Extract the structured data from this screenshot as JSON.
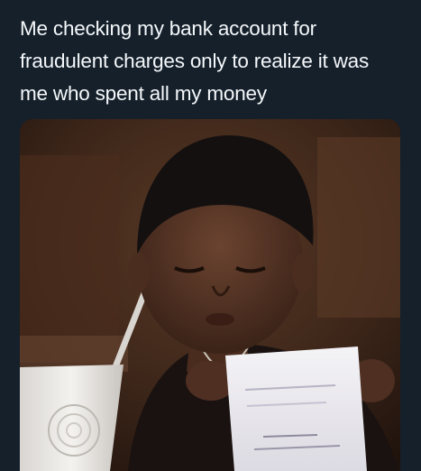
{
  "caption": {
    "lines": [
      "Me checking my bank account for",
      "fraudulent charges only to realize it was",
      "me who spent all my money"
    ]
  },
  "photo": {
    "description_icon": "meme-photo"
  },
  "colors": {
    "background": "#15202b",
    "text": "#f5f8fa"
  }
}
